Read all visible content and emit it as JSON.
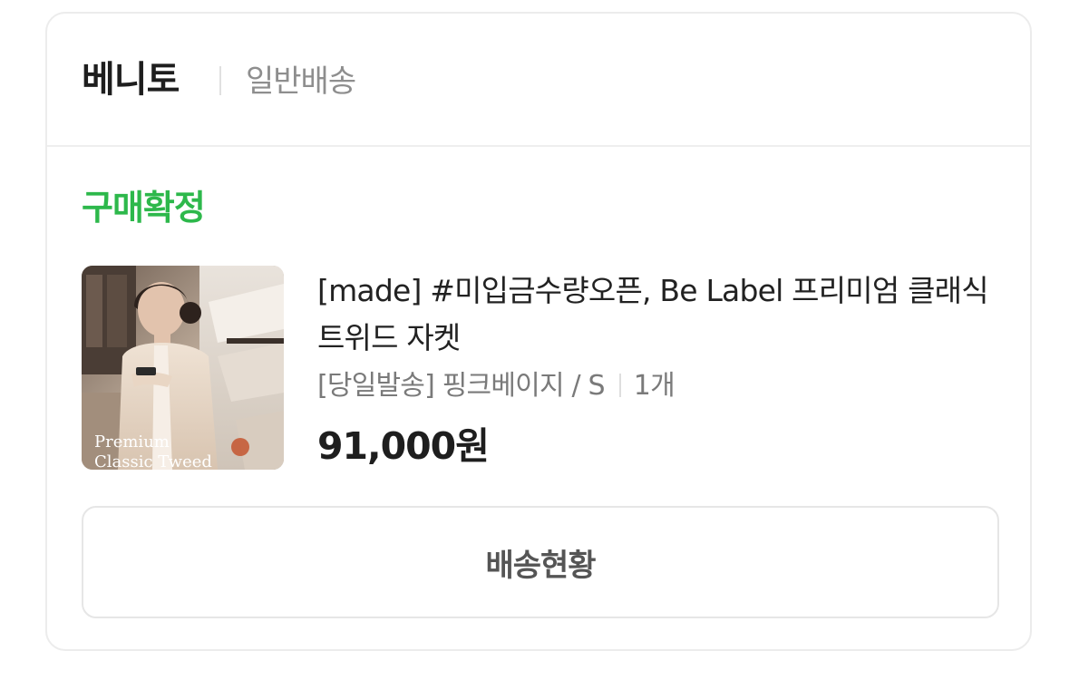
{
  "order": {
    "store_name": "베니토",
    "shipping_type": "일반배송",
    "status": "구매확정",
    "status_color": "#2db84b"
  },
  "product": {
    "title": "[made] #미입금수량오픈, Be Label 프리미엄 클래식 트위드 자켓",
    "option": "[당일발송] 핑크베이지 / S",
    "quantity": "1개",
    "price": "91,000원",
    "thumbnail_caption_line1": "Premium",
    "thumbnail_caption_line2": "Classic Tweed"
  },
  "actions": {
    "track_delivery_label": "배송현황"
  }
}
